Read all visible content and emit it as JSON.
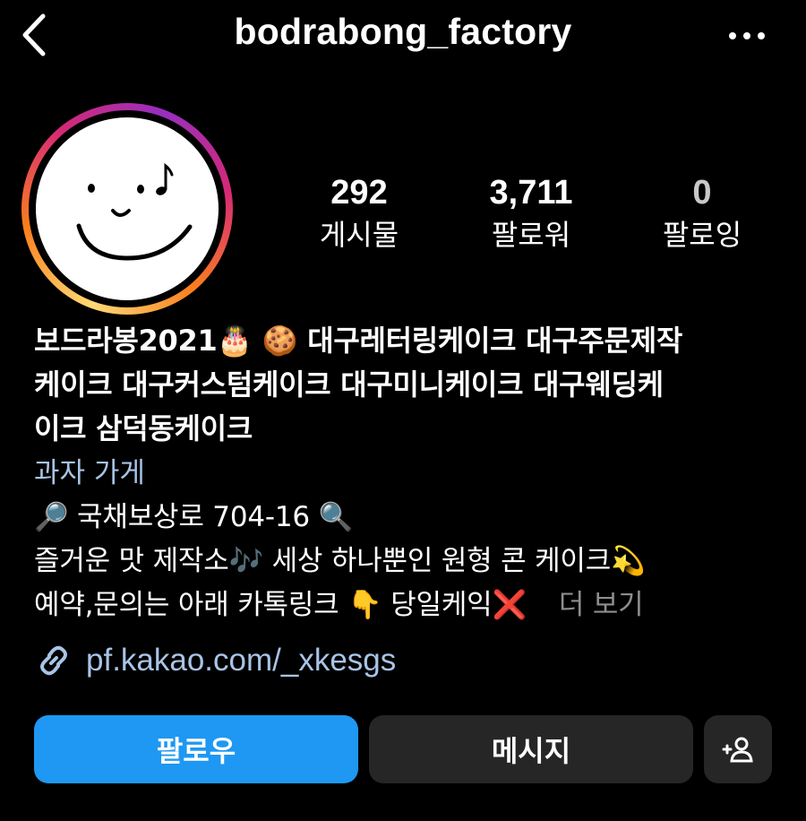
{
  "header": {
    "username": "bodrabong_factory",
    "back_icon": "chevron-left-icon",
    "more_icon": "ellipsis-icon"
  },
  "stats": {
    "posts": {
      "value": "292",
      "label": "게시물"
    },
    "followers": {
      "value": "3,711",
      "label": "팔로워"
    },
    "following": {
      "value": "0",
      "label": "팔로잉"
    }
  },
  "bio": {
    "name_lines": [
      "보드라봉2021🎂 🍪 대구레터링케이크 대구주문제작",
      "케이크 대구커스텀케이크 대구미니케이크 대구웨딩케",
      "이크 삼덕동케이크"
    ],
    "category": "과자 가게",
    "lines": [
      "🔎 국채보상로 704-16 🔍",
      "즐거운 맛 제작소🎶 세상 하나뿐인 원형 콘 케이크💫",
      "예약,문의는 아래 카톡링크 👇 당일케익❌"
    ],
    "more": "더 보기"
  },
  "link": {
    "icon": "link-icon",
    "url": "pf.kakao.com/_xkesgs"
  },
  "buttons": {
    "follow": "팔로우",
    "message": "메시지",
    "suggest_icon": "add-person-icon"
  },
  "colors": {
    "background": "#000000",
    "follow_button": "#1e98f2",
    "secondary_button": "#262626",
    "link": "#a8c4e6",
    "muted": "#8e8e8e"
  }
}
